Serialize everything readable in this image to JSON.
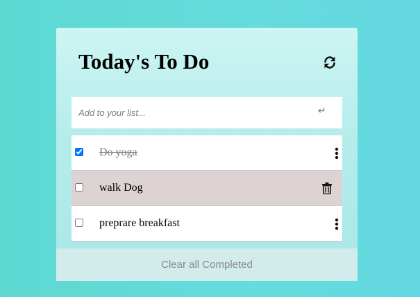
{
  "app": {
    "title": "Today's To Do"
  },
  "input": {
    "placeholder": "Add to your list...",
    "value": "",
    "enter_icon": "enter-arrow-icon"
  },
  "todos": [
    {
      "label": "Do yoga",
      "completed": true,
      "action_icon": "kebab-menu-icon"
    },
    {
      "label": "walk Dog",
      "completed": false,
      "action_icon": "trash-icon"
    },
    {
      "label": "preprare breakfast",
      "completed": false,
      "action_icon": "kebab-menu-icon"
    }
  ],
  "footer": {
    "clear_label": "Clear all Completed"
  },
  "colors": {
    "page_background": "#5fd9d6",
    "card_background": "#b4ecea",
    "selected_row": "#ddd3d3",
    "footer_background": "#d2ecec",
    "footer_text": "#868b8b"
  }
}
